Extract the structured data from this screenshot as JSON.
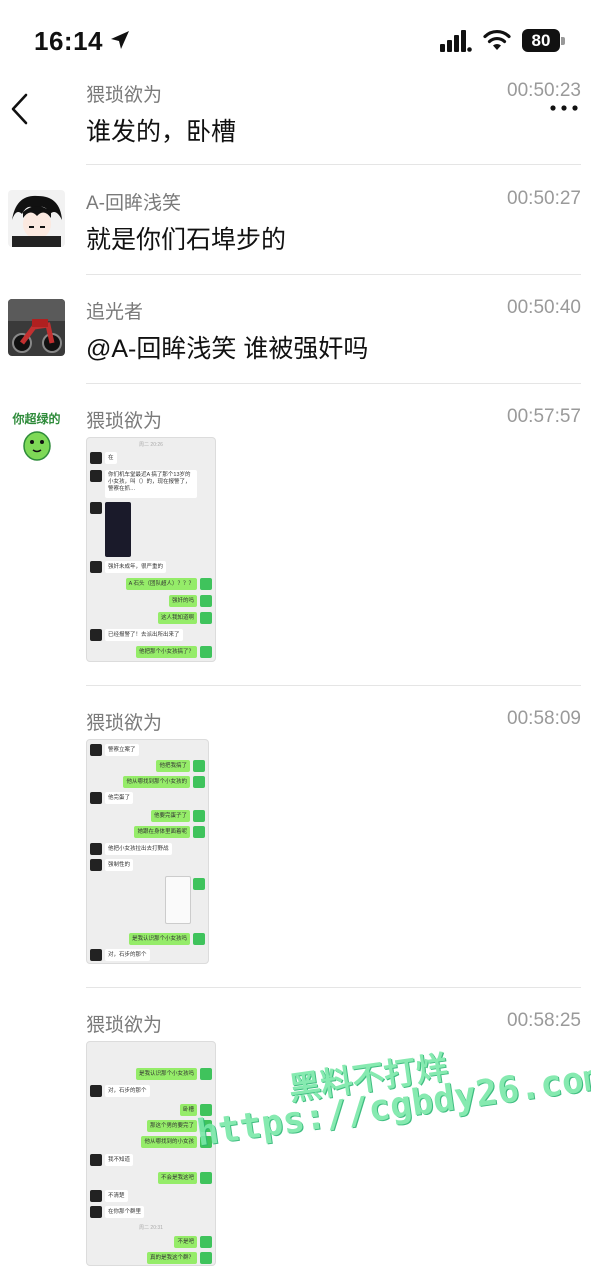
{
  "status_bar": {
    "time": "16:14",
    "battery": "80"
  },
  "messages": [
    {
      "sender": "猥琐欲为",
      "time": "00:50:23",
      "text": "谁发的，卧槽"
    },
    {
      "sender": "A-回眸浅笑",
      "time": "00:50:27",
      "text": "就是你们石埠步的"
    },
    {
      "sender": "追光者",
      "time": "00:50:40",
      "text": "@A-回眸浅笑 谁被强奸吗"
    },
    {
      "sender": "猥琐欲为",
      "time": "00:57:57",
      "avatar_text": "你超绿的",
      "image_lines": [
        "周二 20:26",
        "在",
        "你们机车堂最近A 搞了那个13岁的小女孩，叫（）的，现在报警了，警察在抓…",
        "强奸未成年，很严重的",
        "A 石头（团队超人）？？？",
        "强奸的吗",
        "这人我知道啊",
        "已经报警了！去派出所出来了",
        "他把那个小女孩搞了？"
      ]
    },
    {
      "sender": "猥琐欲为",
      "time": "00:58:09",
      "image_lines": [
        "警察立案了",
        "他把我搞了",
        "他从哪找到那个小女孩的",
        "他完蛋了",
        "他要完蛋子了",
        "她跟在身体里面着呢",
        "他把小女孩拉出去打野战",
        "强制性的",
        "是我认识那个小女孩吗",
        "对，石步的那个"
      ]
    },
    {
      "sender": "猥琐欲为",
      "time": "00:58:25",
      "image_lines": [
        "是我认识那个小女孩吗",
        "对，石步的那个",
        "卧槽",
        "那这个男的要完了",
        "他从哪找到的小女孩",
        "我不知道",
        "不会是我这吧",
        "不清楚",
        "在你那个群里",
        "周二 20:31",
        "不是吧",
        "真的是我这个群？"
      ]
    }
  ],
  "watermark": {
    "line1": "黑料不打烊",
    "line2": "https://cgbdy26.com"
  },
  "icons": [
    "location-arrow-icon",
    "signal-icon",
    "wifi-icon",
    "back-chevron-icon",
    "more-dots-icon"
  ]
}
